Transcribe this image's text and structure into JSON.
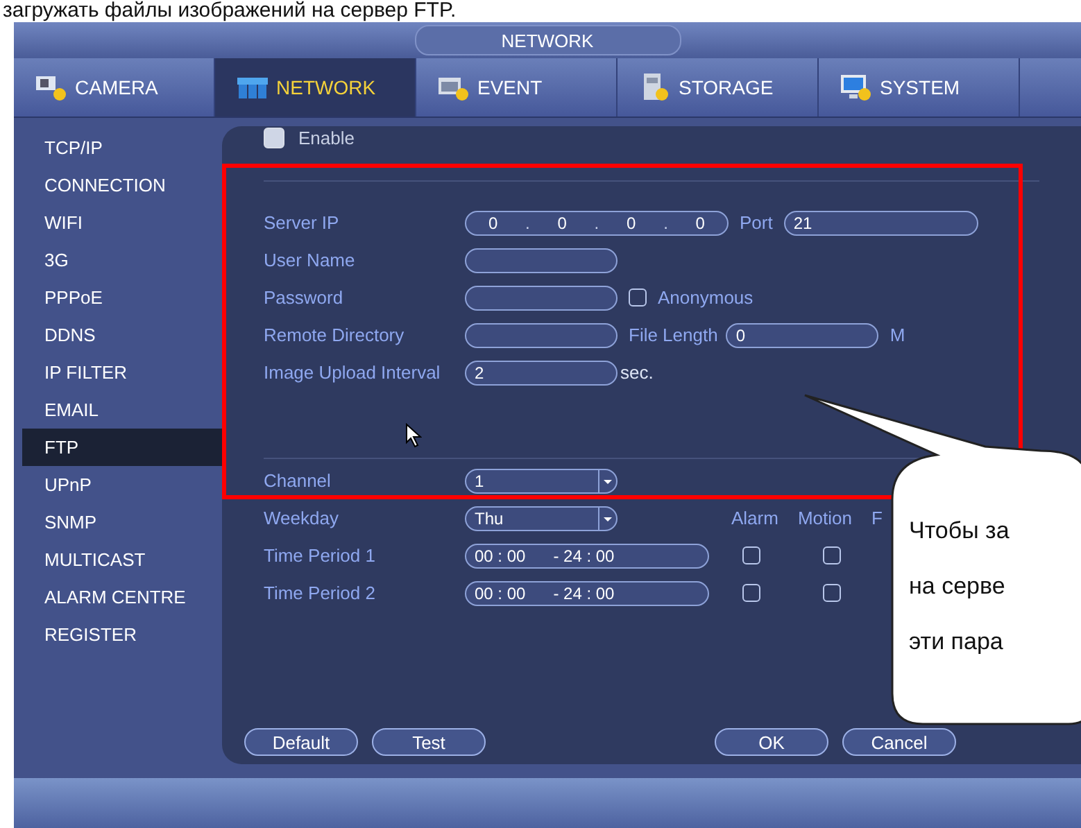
{
  "caption": "загружать файлы изображений на сервер FTP.",
  "window": {
    "title": "NETWORK"
  },
  "tabs": [
    {
      "label": "CAMERA",
      "kind": "camera",
      "selected": false
    },
    {
      "label": "NETWORK",
      "kind": "network",
      "selected": true
    },
    {
      "label": "EVENT",
      "kind": "event",
      "selected": false
    },
    {
      "label": "STORAGE",
      "kind": "storage",
      "selected": false
    },
    {
      "label": "SYSTEM",
      "kind": "system",
      "selected": false
    }
  ],
  "sidebar": {
    "items": [
      {
        "label": "TCP/IP",
        "selected": false
      },
      {
        "label": "CONNECTION",
        "selected": false
      },
      {
        "label": "WIFI",
        "selected": false
      },
      {
        "label": "3G",
        "selected": false
      },
      {
        "label": "PPPoE",
        "selected": false
      },
      {
        "label": "DDNS",
        "selected": false
      },
      {
        "label": "IP FILTER",
        "selected": false
      },
      {
        "label": "EMAIL",
        "selected": false
      },
      {
        "label": "FTP",
        "selected": true
      },
      {
        "label": "UPnP",
        "selected": false
      },
      {
        "label": "SNMP",
        "selected": false
      },
      {
        "label": "MULTICAST",
        "selected": false
      },
      {
        "label": "ALARM CENTRE",
        "selected": false
      },
      {
        "label": "REGISTER",
        "selected": false
      }
    ]
  },
  "enable": {
    "label": "Enable",
    "checked": false
  },
  "fields": [
    {
      "kind": "ip",
      "label": "Server IP",
      "octets": [
        "0",
        "0",
        "0",
        "0"
      ],
      "separator": ".",
      "extra_label": "Port",
      "extra_value": "21"
    },
    {
      "kind": "text",
      "label": "User Name"
    },
    {
      "kind": "check",
      "label": "Password",
      "check_label": "Anonymous",
      "checked": false
    },
    {
      "kind": "extra",
      "label": "Remote Directory",
      "extra_label": "File Length",
      "extra_value": "0",
      "unit": "M"
    },
    {
      "kind": "unit",
      "label": "Image Upload Interval",
      "value": "2",
      "unit": "sec."
    }
  ],
  "schedule": {
    "channel": {
      "label": "Channel",
      "value": "1"
    },
    "weekday": {
      "label": "Weekday",
      "value": "Thu"
    },
    "columns": [
      "Alarm",
      "Motion",
      "F"
    ],
    "periods": [
      {
        "label": "Time Period 1",
        "start": "00 : 00",
        "end": "- 24 :  00",
        "alarm": false,
        "motion": false
      },
      {
        "label": "Time Period 2",
        "start": "00 : 00",
        "end": "- 24 :  00",
        "alarm": false,
        "motion": false
      }
    ]
  },
  "buttons_left": [
    "Default",
    "Test"
  ],
  "buttons_right": [
    "OK",
    "Cancel"
  ],
  "callout": {
    "lines": [
      "Чтобы за",
      "на серве",
      "эти пара"
    ]
  }
}
